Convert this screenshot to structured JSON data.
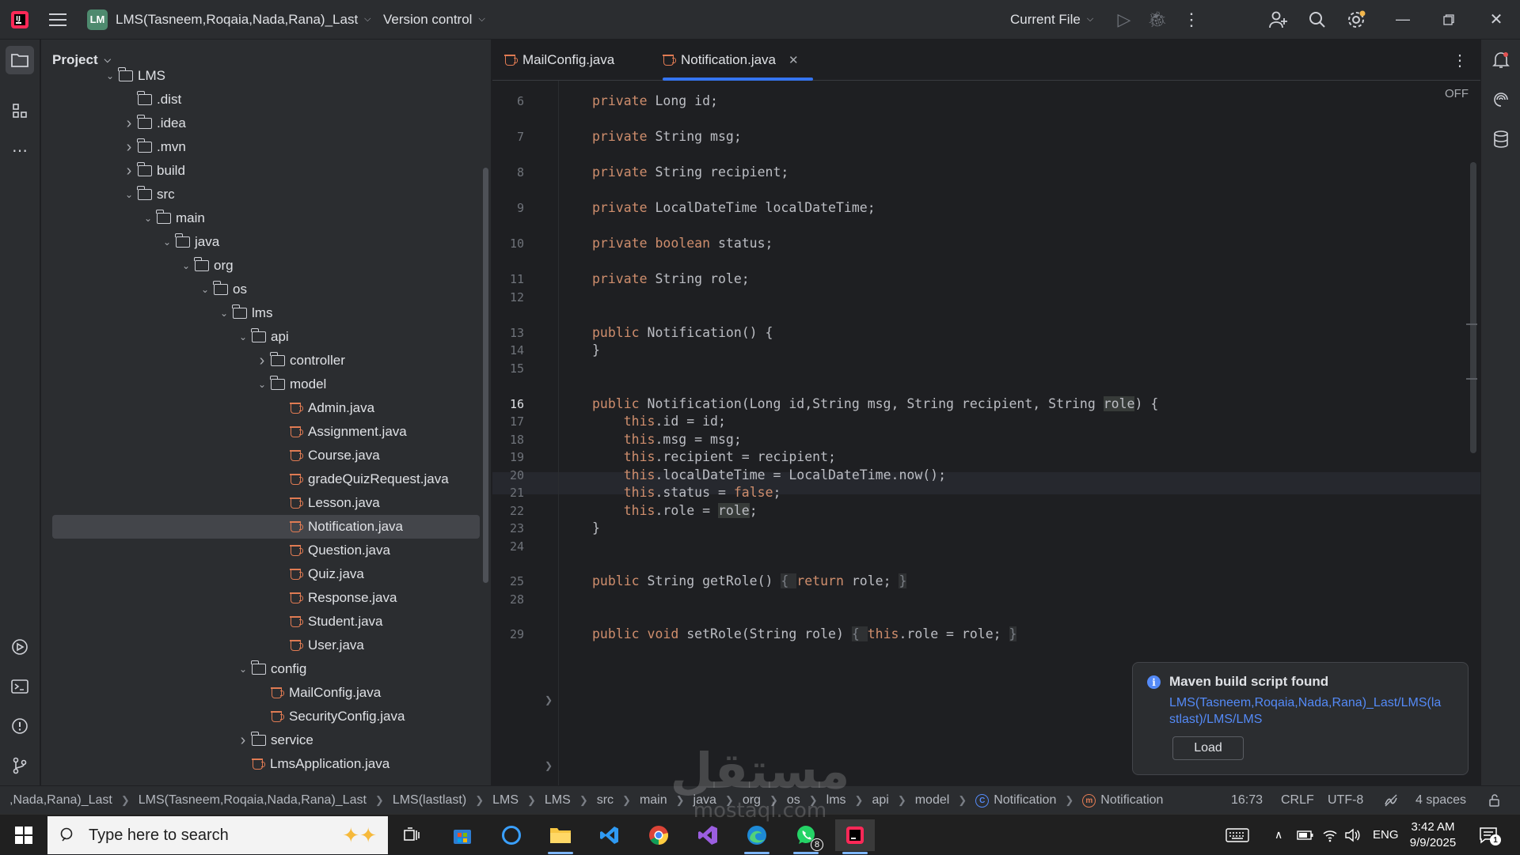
{
  "titlebar": {
    "project_badge": "LM",
    "project_name": "LMS(Tasneem,Roqaia,Nada,Rana)_Last",
    "version_control": "Version control",
    "run_config": "Current File"
  },
  "project_panel": {
    "header": "Project",
    "tree": [
      {
        "label": "LMS",
        "type": "folder",
        "expanded": true,
        "depth": 0
      },
      {
        "label": ".dist",
        "type": "folder",
        "expanded": null,
        "depth": 1
      },
      {
        "label": ".idea",
        "type": "folder",
        "expanded": false,
        "depth": 1
      },
      {
        "label": ".mvn",
        "type": "folder",
        "expanded": false,
        "depth": 1
      },
      {
        "label": "build",
        "type": "folder",
        "expanded": false,
        "depth": 1
      },
      {
        "label": "src",
        "type": "folder",
        "expanded": true,
        "depth": 1
      },
      {
        "label": "main",
        "type": "folder",
        "expanded": true,
        "depth": 2
      },
      {
        "label": "java",
        "type": "folder",
        "expanded": true,
        "depth": 3
      },
      {
        "label": "org",
        "type": "folder",
        "expanded": true,
        "depth": 4
      },
      {
        "label": "os",
        "type": "folder",
        "expanded": true,
        "depth": 5
      },
      {
        "label": "lms",
        "type": "folder",
        "expanded": true,
        "depth": 6
      },
      {
        "label": "api",
        "type": "folder",
        "expanded": true,
        "depth": 7
      },
      {
        "label": "controller",
        "type": "folder",
        "expanded": false,
        "depth": 8
      },
      {
        "label": "model",
        "type": "folder",
        "expanded": true,
        "depth": 8
      },
      {
        "label": "Admin.java",
        "type": "java",
        "depth": 9
      },
      {
        "label": "Assignment.java",
        "type": "java",
        "depth": 9
      },
      {
        "label": "Course.java",
        "type": "java",
        "depth": 9
      },
      {
        "label": "gradeQuizRequest.java",
        "type": "java",
        "depth": 9
      },
      {
        "label": "Lesson.java",
        "type": "java",
        "depth": 9
      },
      {
        "label": "Notification.java",
        "type": "java",
        "depth": 9,
        "selected": true
      },
      {
        "label": "Question.java",
        "type": "java",
        "depth": 9
      },
      {
        "label": "Quiz.java",
        "type": "java",
        "depth": 9
      },
      {
        "label": "Response.java",
        "type": "java",
        "depth": 9
      },
      {
        "label": "Student.java",
        "type": "java",
        "depth": 9
      },
      {
        "label": "User.java",
        "type": "java",
        "depth": 9
      },
      {
        "label": "config",
        "type": "folder",
        "expanded": true,
        "depth": 7
      },
      {
        "label": "MailConfig.java",
        "type": "java",
        "depth": 8
      },
      {
        "label": "SecurityConfig.java",
        "type": "java",
        "depth": 8
      },
      {
        "label": "service",
        "type": "folder",
        "expanded": false,
        "depth": 7
      },
      {
        "label": "LmsApplication.java",
        "type": "java",
        "depth": 7
      }
    ]
  },
  "editor": {
    "tabs": [
      {
        "label": "MailConfig.java",
        "active": false
      },
      {
        "label": "Notification.java",
        "active": true
      }
    ],
    "reader_mode": "OFF",
    "current_line": "16",
    "lines": [
      {
        "n": "6",
        "segs": [
          [
            "kw",
            "private"
          ],
          [
            "t",
            " Long id;"
          ]
        ]
      },
      {
        "n": "7",
        "segs": [
          [
            "kw",
            "private"
          ],
          [
            "t",
            " String msg;"
          ]
        ]
      },
      {
        "n": "8",
        "segs": [
          [
            "kw",
            "private"
          ],
          [
            "t",
            " String recipient;"
          ]
        ]
      },
      {
        "n": "9",
        "segs": [
          [
            "kw",
            "private"
          ],
          [
            "t",
            " LocalDateTime localDateTime;"
          ]
        ]
      },
      {
        "n": "10",
        "segs": [
          [
            "kw",
            "private boolean"
          ],
          [
            "t",
            " status;"
          ]
        ]
      },
      {
        "n": "11",
        "segs": [
          [
            "kw",
            "private"
          ],
          [
            "t",
            " String role;"
          ]
        ]
      },
      {
        "n": "12",
        "segs": []
      },
      {
        "n": "13",
        "segs": [
          [
            "kw",
            "public"
          ],
          [
            "t",
            " Notification() {"
          ]
        ]
      },
      {
        "n": "14",
        "segs": [
          [
            "t",
            "}"
          ]
        ]
      },
      {
        "n": "15",
        "segs": []
      },
      {
        "n": "16",
        "segs": [
          [
            "kw",
            "public"
          ],
          [
            "t",
            " Notification(Long id,String msg, String recipient, String "
          ],
          [
            "hl",
            "role"
          ],
          [
            "t",
            ") {"
          ]
        ]
      },
      {
        "n": "17",
        "segs": [
          [
            "t",
            "    "
          ],
          [
            "kw",
            "this"
          ],
          [
            "t",
            ".id = id;"
          ]
        ]
      },
      {
        "n": "18",
        "segs": [
          [
            "t",
            "    "
          ],
          [
            "kw",
            "this"
          ],
          [
            "t",
            ".msg = msg;"
          ]
        ]
      },
      {
        "n": "19",
        "segs": [
          [
            "t",
            "    "
          ],
          [
            "kw",
            "this"
          ],
          [
            "t",
            ".recipient = recipient;"
          ]
        ]
      },
      {
        "n": "20",
        "segs": [
          [
            "t",
            "    "
          ],
          [
            "kw",
            "this"
          ],
          [
            "t",
            ".localDateTime = LocalDateTime.now();"
          ]
        ]
      },
      {
        "n": "21",
        "segs": [
          [
            "t",
            "    "
          ],
          [
            "kw",
            "this"
          ],
          [
            "t",
            ".status = "
          ],
          [
            "kw",
            "false"
          ],
          [
            "t",
            ";"
          ]
        ]
      },
      {
        "n": "22",
        "segs": [
          [
            "t",
            "    "
          ],
          [
            "kw",
            "this"
          ],
          [
            "t",
            ".role = "
          ],
          [
            "hl",
            "role"
          ],
          [
            "t",
            ";"
          ]
        ]
      },
      {
        "n": "23",
        "segs": [
          [
            "t",
            "}"
          ]
        ]
      },
      {
        "n": "24",
        "segs": []
      },
      {
        "n": "25",
        "segs": [
          [
            "kw",
            "public"
          ],
          [
            "t",
            " String getRole() "
          ],
          [
            "fb",
            "{ "
          ],
          [
            "kw",
            "return"
          ],
          [
            "t",
            " role; "
          ],
          [
            "fb",
            "}"
          ]
        ]
      },
      {
        "n": "28",
        "segs": []
      },
      {
        "n": "29",
        "segs": [
          [
            "kw",
            "public void"
          ],
          [
            "t",
            " setRole(String role) "
          ],
          [
            "fb",
            "{ "
          ],
          [
            "kw",
            "this"
          ],
          [
            "t",
            ".role = role; "
          ],
          [
            "fb",
            "}"
          ]
        ]
      }
    ]
  },
  "notification": {
    "title": "Maven build script found",
    "link": "LMS(Tasneem,Roqaia,Nada,Rana)_Last/LMS(lastlast)/LMS/LMS",
    "button": "Load"
  },
  "statusbar": {
    "breadcrumbs": [
      ",Nada,Rana)_Last",
      "LMS(Tasneem,Roqaia,Nada,Rana)_Last",
      "LMS(lastlast)",
      "LMS",
      "LMS",
      "src",
      "main",
      "java",
      "org",
      "os",
      "lms",
      "api",
      "model"
    ],
    "class_crumb": "Notification",
    "member_crumb": "Notification",
    "position": "16:73",
    "line_sep": "CRLF",
    "encoding": "UTF-8",
    "indent": "4 spaces"
  },
  "taskbar": {
    "search_placeholder": "Type here to search",
    "whatsapp_badge": "8",
    "lang": "ENG",
    "time": "3:42 AM",
    "date": "9/9/2025"
  },
  "watermark": {
    "arabic": "مستقل",
    "latin": "mostaql.com"
  },
  "colors": {
    "accent": "#3574f0",
    "keyword": "#cf8e6d",
    "link": "#548af7",
    "java_icon": "#e07b53"
  }
}
